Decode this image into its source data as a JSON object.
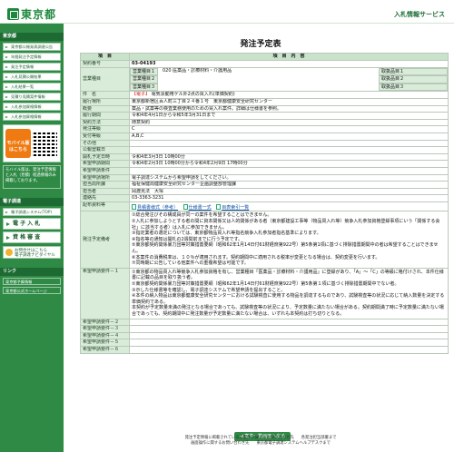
{
  "header": {
    "logo_text": "東京都",
    "service_name": "入札情報サービス"
  },
  "sidebar": {
    "section1": "東京都",
    "menu": [
      "東京都公報発表調達公告",
      "年間発注予定情報",
      "発注予定情報",
      "入札見積公開結果",
      "入札結果一覧",
      "見積り見積案件情報",
      "入札参加資格情報",
      "入札参加資格情報"
    ],
    "mobile_label": "モバイル版",
    "mobile_sub": "はこちら",
    "note": "モバイル版は、発注予定情報と入札（見積）経過情報のみ掲載しております。",
    "section2": "電子調達",
    "ep_link": "電子調達システム(TOP)",
    "big1": "電 子 入 札",
    "big2": "資 格 審 査",
    "inquiry_title": "お問合せはこちら",
    "inquiry_sub": "電子調達ナビダイヤル",
    "section3": "リンク",
    "links": [
      "東京都予算情報",
      "東京都公式ホームページ"
    ]
  },
  "main": {
    "title": "発注予定表",
    "header_row": {
      "item": "項　目",
      "content": "項　目　内　容"
    },
    "rows": {
      "contract_no": {
        "label": "契約番号",
        "value": "03-04193"
      },
      "business_type": {
        "label": "営業種目",
        "lines": [
          {
            "name": "営業種目１",
            "value": "020 医薬品・診療材料・介護用品",
            "tag": "取扱品目１"
          },
          {
            "name": "営業種目２",
            "value": "",
            "tag": "取扱品目２"
          },
          {
            "name": "営業種目３",
            "value": "",
            "tag": "取扱品目３"
          }
        ]
      },
      "name": {
        "label": "件　名",
        "badge": "【電子】",
        "value": "電気泳動用ゲル外2点の買入れ(単価契約)"
      },
      "place": {
        "label": "履行場所",
        "value": "東京都新宿区百人町三丁目２４番１号　東京都健康安全研究センター"
      },
      "summary": {
        "label": "概要",
        "value": "薬品・試薬等の検査業務使用のための買入れ案件。詳細は仕様書を参照。"
      },
      "period": {
        "label": "履行期間",
        "value": "令和4年4月1日から令和5年3月31日まで"
      },
      "method": {
        "label": "契約方法",
        "value": "随意契約"
      },
      "order_type": {
        "label": "発注等級",
        "value": "C"
      },
      "accept_grade": {
        "label": "受付等級",
        "value": "A,B,C"
      },
      "other": {
        "label": "その他",
        "value": ""
      },
      "pub_date": {
        "label": "公報登載日",
        "value": ""
      },
      "open_date": {
        "label": "開札予定日時",
        "value": "令和4年3月3日 10時00分"
      },
      "apply_period": {
        "label": "希望申請期間",
        "value": "令和4年2月3日 10時00分から令和4年2月9日 17時00分"
      },
      "apply_cond": {
        "label": "希望申請条件",
        "value": ""
      },
      "apply_method": {
        "label": "希望申請場所",
        "value": "電子調達システムから希望申請をしてください。"
      },
      "section": {
        "label": "担当局所課",
        "value": "福祉保健局健康安全研究センター企画調整部管理課"
      },
      "person": {
        "label": "担当者",
        "value": "岡渡見法　大塚"
      },
      "tel": {
        "label": "連絡先",
        "value": "03-3363-3231"
      },
      "docs": {
        "label": "配布資料等",
        "links": [
          "見積書様式（参考）",
          "仕様書一式",
          "目表索引一覧"
        ]
      },
      "notes": {
        "label": "発注予定備考",
        "lines": [
          "①総合発注びその構成員が同一の案件を希望することはできません。",
          "②入札に参加しようとする者の間に資本関係又は人的関係がある者（東京都建設工事等（物品買入れ等）競争入札参加資格登録事項にいう「関係する会社」に該当する者）は入札に参加できません。",
          "③指定業者の選定については、東京都物品買入れ等指名競争入札参加者指名基準によります。",
          "④指名等の通知は開札の2週間前までに行う予定です。",
          "⑤東京都契約関係暴力団等対策措置要綱（昭和62年1月14日付61財経庶第922号）第5条第1項に基づく排除措置期間中の者は希望することはできません。",
          "⑥本案件の消費税率は、１０％が適用されます。契約期間中に適用される税率が変更となる場合は、契約変更を行います。",
          "⑦同時期に公告している他案件への重複希望は可能です。"
        ]
      },
      "req1": {
        "label": "希望申請要件－１",
        "lines": [
          "①東京都の物品買入れ等競争入札参加資格を有し、営業種目「医薬品・診療材料・介護用品」に登録があり、「A」～「C」の等級に格付けされ、本件仕様書に記載の品目を取り扱う者。",
          "②東京都契約関係暴力団等対策措置要綱（昭和62年1月14日付61財経庶第922号）第5条第１項に基づく排除措置期間中でない者。",
          "③示した仕様書等を確認し、電子調達システムで希望申請を提出すること。",
          "④本件の納入物品は東京都健康安全研究センターにおける試験検査に使用する物品を調達するものであり、試験検査等の状況に応じて納入数量を決定する単価契約である。",
          "本契約が予定数量未満の発注となる場合であっても、試験検査等の状況により、予定数量に満たない場合がある。契約期間満了時に予定数量に満たない場合であっても、契約期間中に発注数量が予定数量に満たない場合は、いずれも本契約は打ち切りとなる。"
        ]
      },
      "req2": {
        "label": "希望申請要件－２",
        "value": ""
      },
      "req3": {
        "label": "希望申請要件－３",
        "value": ""
      },
      "req4": {
        "label": "希望申請要件－４",
        "value": ""
      },
      "req5": {
        "label": "希望申請要件－５",
        "value": ""
      },
      "req6": {
        "label": "希望申請要件－６",
        "value": ""
      }
    },
    "back_button": "◀ 案件一覧画面へ戻る"
  },
  "footer": {
    "line1a": "発注予定情報に掲載されている各案件に関するお問い合わせ先",
    "line1b": "各発注担当部署まで",
    "line2a": "画面操作に関するお問い合わせ先",
    "line2b": "東京都電子調達システムヘルプデスクまで"
  },
  "colors": {
    "brand_green": "#1e8a3e",
    "sidebar_green": "#2f8a46",
    "label_bg": "#d8ecd9"
  }
}
